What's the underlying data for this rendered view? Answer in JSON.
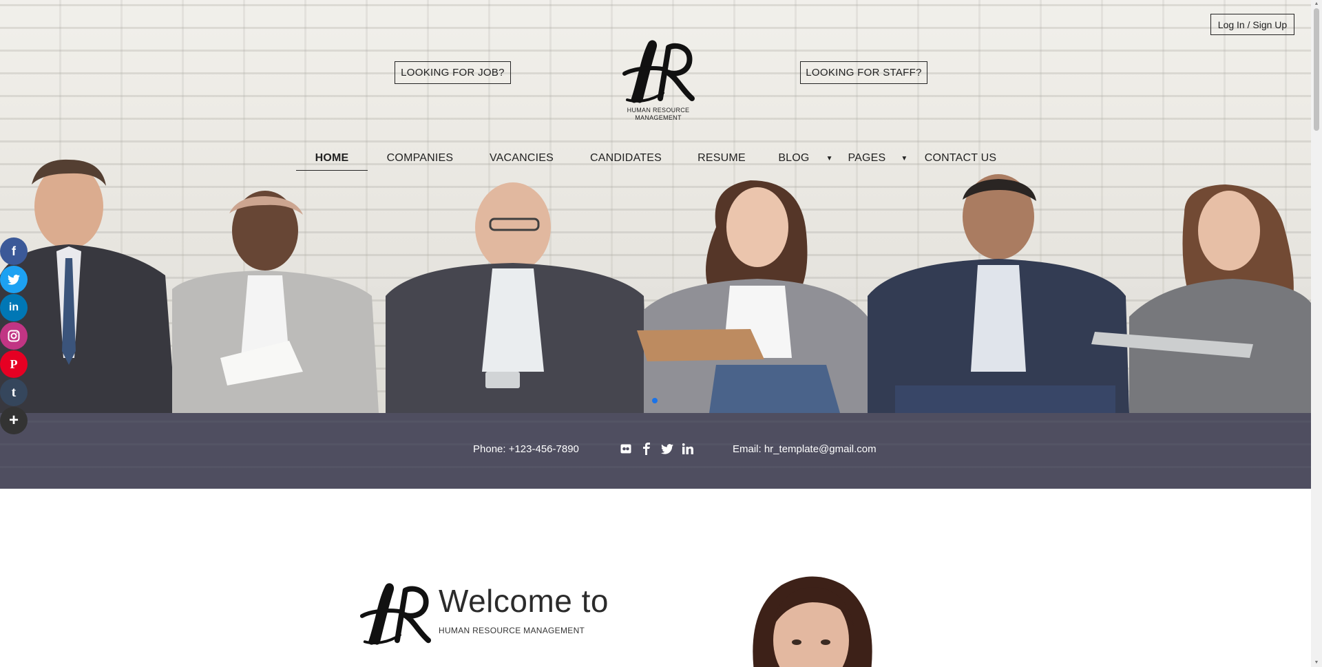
{
  "header": {
    "login_label": "Log In / Sign Up",
    "cta_job": "LOOKING FOR JOB?",
    "cta_staff": "LOOKING FOR STAFF?",
    "logo_subtitle_line1": "HUMAN RESOURCE",
    "logo_subtitle_line2": "MANAGEMENT"
  },
  "nav": {
    "items": [
      {
        "label": "HOME",
        "active": true
      },
      {
        "label": "COMPANIES"
      },
      {
        "label": "VACANCIES"
      },
      {
        "label": "CANDIDATES"
      },
      {
        "label": "RESUME"
      },
      {
        "label": "BLOG",
        "has_dropdown": true
      },
      {
        "label": "PAGES",
        "has_dropdown": true
      },
      {
        "label": "CONTACT US"
      }
    ],
    "caret": "▼"
  },
  "contact": {
    "phone": "Phone: +123-456-7890",
    "email": "Email: hr_template@gmail.com",
    "icons": [
      "flickr-icon",
      "facebook-icon",
      "twitter-icon",
      "linkedin-icon"
    ]
  },
  "social_sidebar": [
    {
      "name": "facebook-icon",
      "glyph": "f",
      "color": "#3b5998"
    },
    {
      "name": "twitter-icon",
      "glyph": "t",
      "color": "#1da1f2"
    },
    {
      "name": "linkedin-icon",
      "glyph": "in",
      "color": "#0077b5"
    },
    {
      "name": "instagram-icon",
      "glyph": "◎",
      "color": "#c13584"
    },
    {
      "name": "pinterest-icon",
      "glyph": "P",
      "color": "#e60023"
    },
    {
      "name": "tumblr-icon",
      "glyph": "t",
      "color": "#35465c"
    },
    {
      "name": "plus-icon",
      "glyph": "+",
      "color": "#333333"
    }
  ],
  "welcome": {
    "title": "Welcome to",
    "subtitle": "HUMAN RESOURCE MANAGEMENT"
  },
  "colors": {
    "contact_bar": "#4f4e60",
    "slider_dot": "#1a73e8"
  }
}
